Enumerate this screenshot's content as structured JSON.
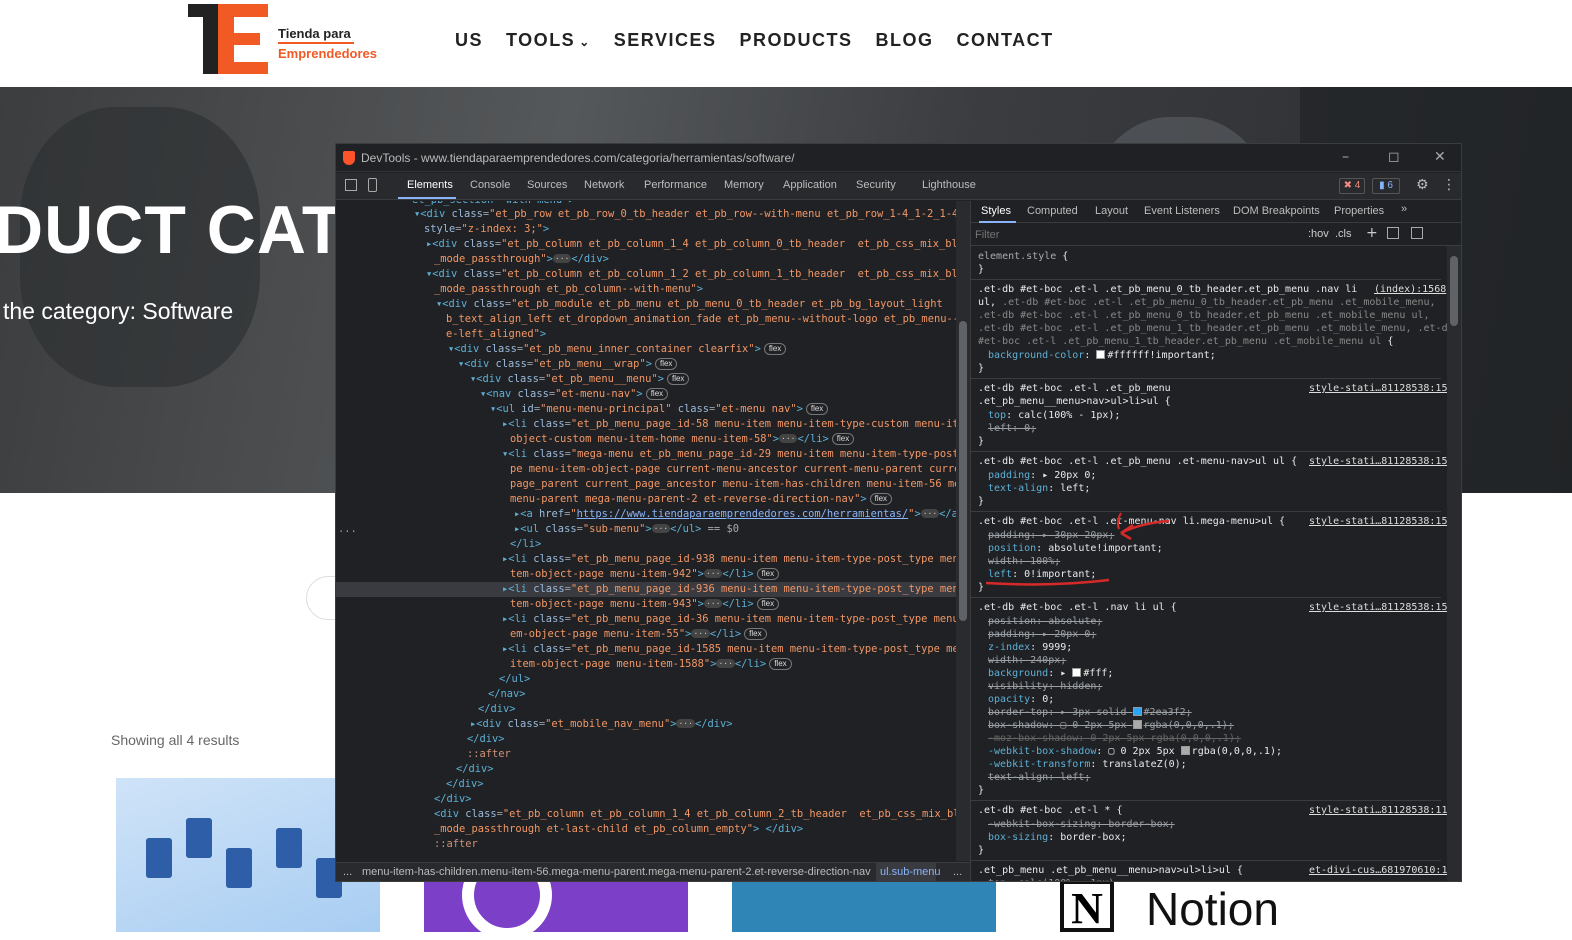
{
  "site": {
    "brand_line1": "Tienda para",
    "brand_line2": "Emprendedores",
    "nav": [
      "US",
      "TOOLS",
      "SERVICES",
      "PRODUCTS",
      "BLOG",
      "CONTACT"
    ],
    "hero_title": "DUCT CATEG",
    "hero_subtitle": "the category: Software",
    "results_text": "Showing all 4 results",
    "notion_label": "Notion",
    "notion_letter": "N"
  },
  "devtools": {
    "title": "DevTools - www.tiendaparaemprendedores.com/categoria/herramientas/software/",
    "tabs": [
      "Elements",
      "Console",
      "Sources",
      "Network",
      "Performance",
      "Memory",
      "Application",
      "Security",
      "Lighthouse"
    ],
    "error_count": "4",
    "message_count": "6",
    "styles_tabs": [
      "Styles",
      "Computed",
      "Layout",
      "Event Listeners",
      "DOM Breakpoints",
      "Properties"
    ],
    "filter_placeholder": "Filter",
    "hov": ":hov",
    "cls": ".cls",
    "breadcrumb_1": "menu-item-has-children.menu-item-56.mega-menu-parent.mega-menu-parent-2.et-reverse-direction-nav",
    "breadcrumb_2": "ul.sub-menu",
    "breadcrumb_more": "...",
    "selected_marker": "== $0",
    "gutter_dots": "..."
  },
  "colors": {
    "brand_orange": "#f15a24",
    "devtools_bg": "#202124",
    "annotation_red": "#d62a2a"
  }
}
